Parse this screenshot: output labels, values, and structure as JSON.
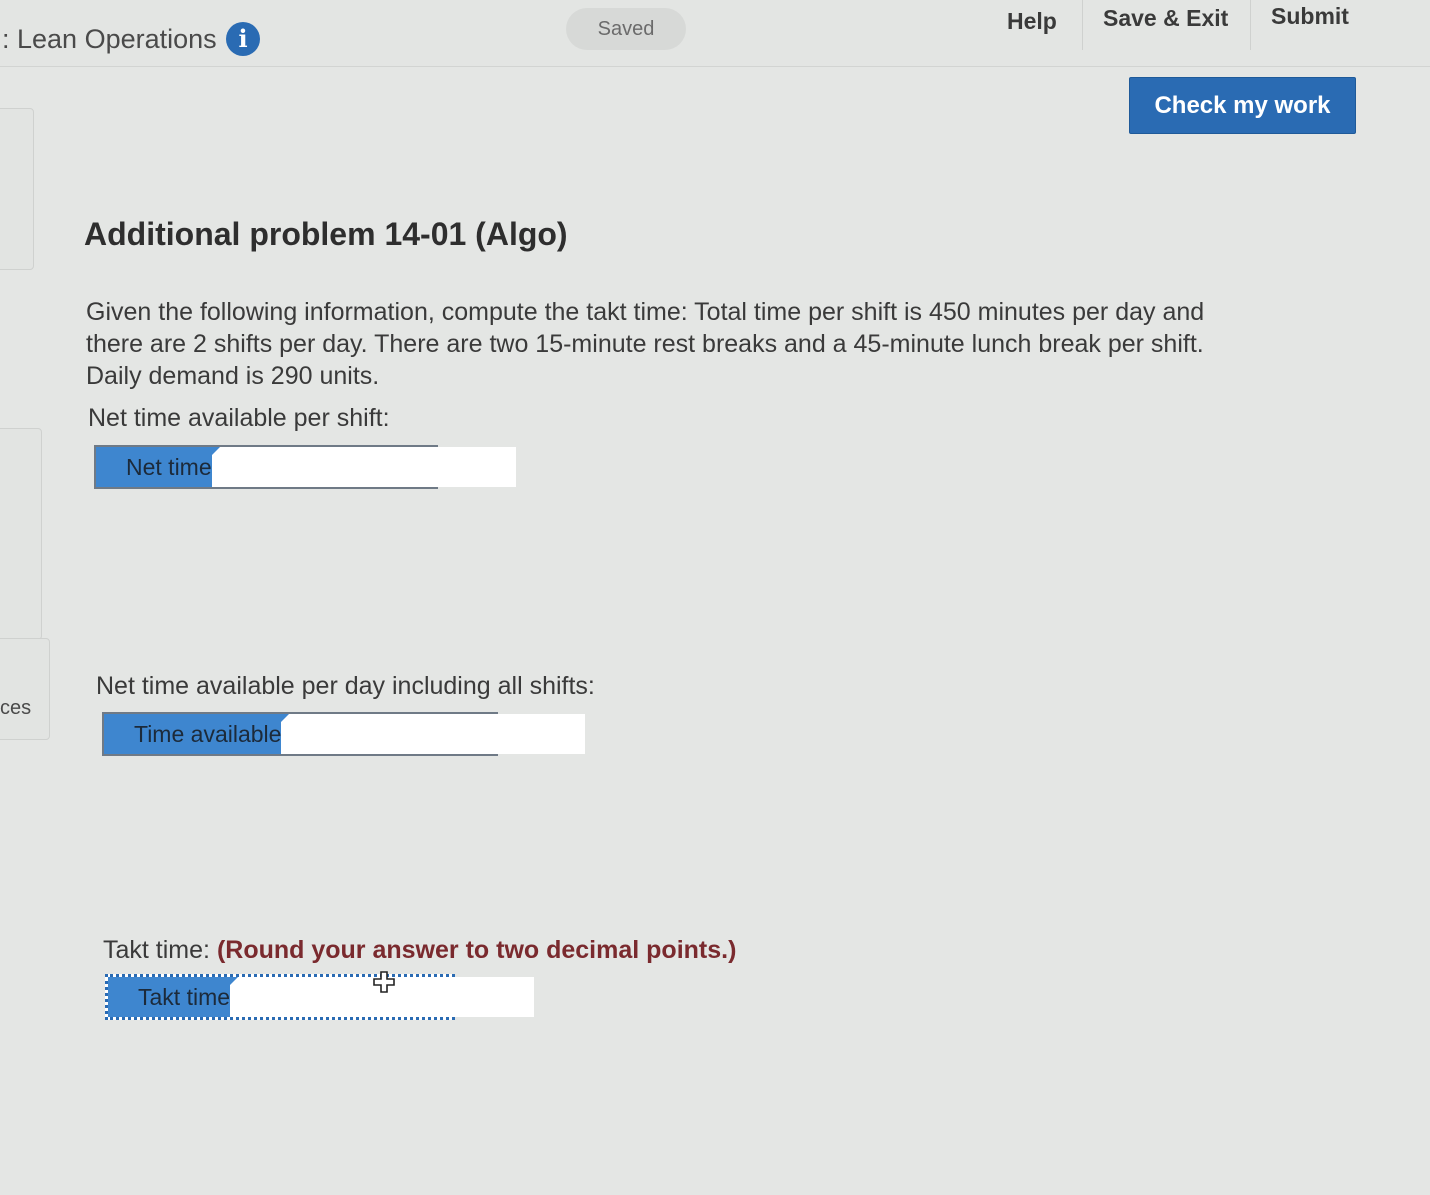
{
  "header": {
    "course_title": ": Lean Operations",
    "saved_label": "Saved",
    "links": [
      "Help",
      "Save & Exit",
      "Submit"
    ],
    "check_button": "Check my work"
  },
  "left_panel": {
    "partial_text": "ces"
  },
  "problem": {
    "title": "Additional problem 14-01 (Algo)",
    "question_lines": [
      "Given the following information, compute the takt time: Total time per shift is 450 minutes per day and",
      "there are 2 shifts per day. There are two 15-minute rest breaks and a 45-minute lunch break per shift.",
      "Daily demand is 290 units."
    ],
    "net_time_prompt": "Net time available per shift:",
    "net_time_label": "Net time",
    "net_time_value": "",
    "time_available_prompt": "Net time available per day including all shifts:",
    "time_available_label": "Time available",
    "time_available_value": "",
    "takt_prompt": "Takt time:",
    "takt_round_note": "(Round your answer to two decimal points.)",
    "takt_label": "Takt time",
    "takt_value": ""
  },
  "colors": {
    "accent": "#2a6bb3",
    "label_fill": "#3e86cf",
    "round_note": "#7a2a2e",
    "background": "#e4e6e4"
  },
  "icons": {
    "info": "info-icon",
    "cursor": "move-cursor-icon"
  }
}
